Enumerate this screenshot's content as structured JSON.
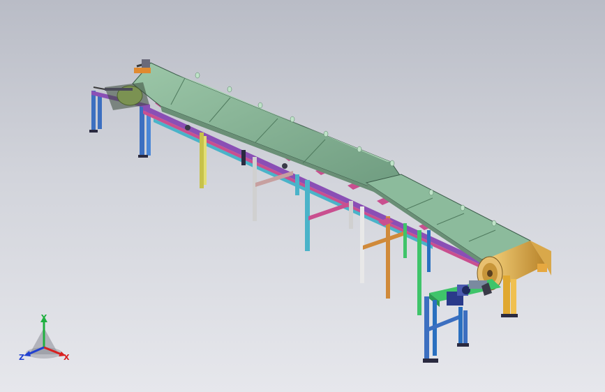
{
  "viewport": {
    "background_top": "#b9bcc6",
    "background_bottom": "#e6e7ec"
  },
  "model": {
    "belt_color": "#86b596",
    "frame_colors": [
      "#3c6fc0",
      "#8a4fb5",
      "#3fc46a",
      "#c7c24a",
      "#d08a3a",
      "#c94f8f",
      "#4ab3c9",
      "#d0d0d0"
    ],
    "drive_color": "#2a3a8a",
    "pulley_color": "#e0b04a"
  },
  "triad": {
    "x_label": "X",
    "y_label": "Y",
    "z_label": "Z",
    "x_color": "#d82020",
    "y_color": "#20b040",
    "z_color": "#2040d0"
  }
}
